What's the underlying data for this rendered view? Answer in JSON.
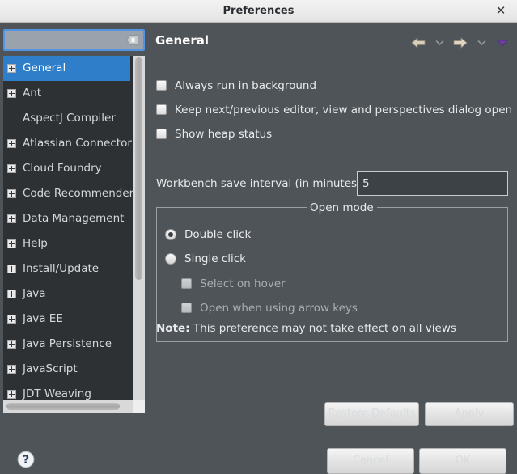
{
  "window": {
    "title": "Preferences",
    "close_label": "✕"
  },
  "sidebar": {
    "search": {
      "value": "",
      "placeholder": "",
      "clear_icon": "clear-x-icon"
    },
    "items": [
      {
        "label": "General",
        "expandable": true,
        "selected": true
      },
      {
        "label": "Ant",
        "expandable": true,
        "selected": false
      },
      {
        "label": "AspectJ Compiler",
        "expandable": false,
        "selected": false
      },
      {
        "label": "Atlassian Connector",
        "expandable": true,
        "selected": false
      },
      {
        "label": "Cloud Foundry",
        "expandable": true,
        "selected": false
      },
      {
        "label": "Code Recommenders",
        "expandable": true,
        "selected": false
      },
      {
        "label": "Data Management",
        "expandable": true,
        "selected": false
      },
      {
        "label": "Help",
        "expandable": true,
        "selected": false
      },
      {
        "label": "Install/Update",
        "expandable": true,
        "selected": false
      },
      {
        "label": "Java",
        "expandable": true,
        "selected": false
      },
      {
        "label": "Java EE",
        "expandable": true,
        "selected": false
      },
      {
        "label": "Java Persistence",
        "expandable": true,
        "selected": false
      },
      {
        "label": "JavaScript",
        "expandable": true,
        "selected": false
      },
      {
        "label": "JDT Weaving",
        "expandable": true,
        "selected": false
      }
    ],
    "help_icon": "help-question-icon"
  },
  "page": {
    "title": "General",
    "toolbar": [
      {
        "name": "back-arrow-icon",
        "glyph": "⬅"
      },
      {
        "name": "back-dropdown-icon",
        "glyph": "⌄"
      },
      {
        "name": "forward-arrow-icon",
        "glyph": "➡"
      },
      {
        "name": "forward-dropdown-icon",
        "glyph": "⌄"
      },
      {
        "name": "view-menu-icon",
        "glyph": "▼"
      }
    ],
    "checkboxes": [
      {
        "label": "Always run in background",
        "checked": false
      },
      {
        "label": "Keep next/previous editor, view and perspectives dialog open",
        "checked": false
      },
      {
        "label": "Show heap status",
        "checked": false
      }
    ],
    "save_interval": {
      "label": "Workbench save interval (in minutes):",
      "value": "5"
    },
    "open_mode": {
      "legend": "Open mode",
      "options": [
        {
          "label": "Double click",
          "selected": true
        },
        {
          "label": "Single click",
          "selected": false
        }
      ],
      "sub_options": [
        {
          "label": "Select on hover",
          "checked": false,
          "enabled": false
        },
        {
          "label": "Open when using arrow keys",
          "checked": false,
          "enabled": false
        }
      ],
      "note_prefix": "Note:",
      "note_text": "This preference may not take effect on all views"
    }
  },
  "buttons": {
    "restore_defaults": "Restore Defaults",
    "apply": "Apply",
    "cancel": "Cancel",
    "ok": "OK"
  },
  "colors": {
    "dialog_bg": "#4e5458",
    "titlebar_bg": "#ebebeb",
    "tree_bg": "#2e3133",
    "selection_blue": "#2e7ec9",
    "focus_blue": "#5294e2",
    "accent_purple": "#6b3fa0",
    "text_light": "#e9eaeb"
  }
}
